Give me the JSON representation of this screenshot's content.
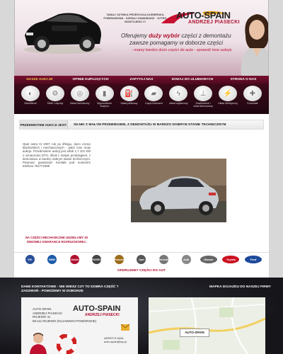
{
  "header": {
    "tagline": "TANIA I SZYBKA PRZESYŁKA KURIERSKA POBRANIOWA · DZISIAJ ZAMAWIASZ · JUTRO MONTUJESZ !!!",
    "logo_text": "AUTO-SPAIN",
    "logo_sub": "ANDRZEJ PIASECKI",
    "promo_prefix": "Oferujemy",
    "promo_highlight": "duży wybór",
    "promo_suffix": "części z demontażu",
    "promo_line2": "zawsze pomagamy w doborze części",
    "promo_line3": "- mamy bardzo dużo części do auta - sprawdź inne aukcje"
  },
  "nav": {
    "items": [
      "NASZE AUKCJE",
      "OPINIE KUPUJĄCYCH",
      "ZAPYTAJ NAS",
      "DODAJ DO ULUBIONYCH",
      "STRONA O NAS"
    ]
  },
  "categories": [
    {
      "label": "Oświetlenie",
      "icon": "headlight-icon"
    },
    {
      "label": "Silnik i osprzęt",
      "icon": "engine-icon"
    },
    {
      "label": "Układ hamulcowy",
      "icon": "brake-disc-icon"
    },
    {
      "label": "Wyposażenie wnętrza",
      "icon": "seat-icon"
    },
    {
      "label": "Układ paliwowy",
      "icon": "fuel-pump-icon"
    },
    {
      "label": "Części karoserii",
      "icon": "body-part-icon"
    },
    {
      "label": "Układ zapłonowy",
      "icon": "ignition-icon"
    },
    {
      "label": "Zawieszenie i układ kierowniczy",
      "icon": "suspension-icon"
    },
    {
      "label": "Układ elektryczny",
      "icon": "electrical-icon"
    },
    {
      "label": "Pozostałe",
      "icon": "other-parts-icon"
    }
  ],
  "listing": {
    "breadcrumb_label": "PRZEDMIOTEM AUKCJI JEST:",
    "title": "SILNIK Z MAŁYM PRZEBIEGIEM, Z DEMONTAŻU W BARDZO DOBRYM STANIE TECHNICZNYM",
    "description": "Opel astra III 2007 rok po liftingu, duzo czesci blacharskich i mechanicznych - patrz inne moje aukcje. Przedmiotem aukcji jest silnik 1,7 101 KM o oznaczeniu DTH. Silnik z malym przebiegiem, z demontazu w bardzo dobrym stanie technicznym. Pewnosc gwarancji!! Kontakt pod numerem telefonu 791771999",
    "warranty": "NA CZĘŚCI MECHANICZNE UDZIELAMY 30 DNIOWEJ GWARANCJI ROZRUCHOWEJ."
  },
  "brands": [
    {
      "name": "VW",
      "color": "#2a4f9a"
    },
    {
      "name": "BMW",
      "color": "#1c5ba8"
    },
    {
      "name": "Citroën",
      "color": "#b01030"
    },
    {
      "name": "PEUGEOT",
      "color": "#444444"
    },
    {
      "name": "Porsche",
      "color": "#9a6b1a"
    },
    {
      "name": "Opel",
      "color": "#555555"
    },
    {
      "name": "Mercedes",
      "color": "#777777"
    },
    {
      "name": "Audi",
      "color": "#888888"
    },
    {
      "name": "Nissan",
      "color": "#666666"
    },
    {
      "name": "Toyota",
      "color": "#cc1020"
    },
    {
      "name": "Ford",
      "color": "#1d4a9c"
    }
  ],
  "parts_link": "OFERUJEMY CZĘŚCI DO AUT",
  "footer": {
    "contact_heading_1": "DANE KONTAKTOWE - NIE WIESZ CZY TO DOBRA CZĘŚĆ ?",
    "contact_heading_2": "ZADZWOŃ - POMOŻEMY W DOBORZE",
    "map_heading": "MAPKA DOJAZDU DO NASZEJ FIRMY",
    "address_lines": [
      "AUTO-SPAIN",
      "ANDRZEJ PIASECKI",
      "ROJEWO 41",
      "88-111 ROJEWO (KUJAWSKO-POMORSKIE)"
    ],
    "card_logo": "AUTO-SPAIN",
    "card_logo_sub": "ANDRZEJ PIASECKI",
    "email_label": "ADRES E-MAIL",
    "email": "auto-spain@wp.pl",
    "map_label": "AUTO-SPAIN"
  },
  "colors": {
    "accent": "#b01030",
    "nav_active": "#f6c64a",
    "nav_bg": "#6a0e28"
  }
}
